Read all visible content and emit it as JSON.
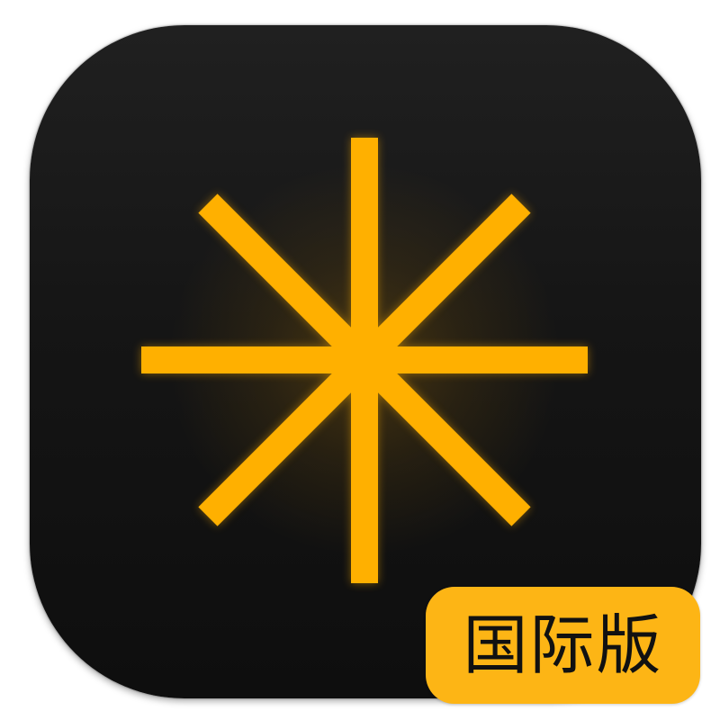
{
  "icon": {
    "symbol": "asterisk-icon",
    "background_color": "#151515",
    "star_color": "#FFB000"
  },
  "badge": {
    "label": "国际版",
    "background_color": "#FDB515",
    "text_color": "#111111"
  }
}
